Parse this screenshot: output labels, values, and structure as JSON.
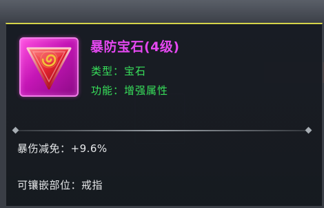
{
  "item": {
    "name": "暴防宝石(4级)",
    "type_line": "类型：宝石",
    "function_line": "功能：增强属性",
    "quality_color": "#e448f0",
    "attr_color": "#38e05b",
    "icon": "gem-icon"
  },
  "stats": [
    {
      "label": "暴伤减免：+9.6%"
    },
    {
      "label": "可镶嵌部位：戒指"
    }
  ]
}
